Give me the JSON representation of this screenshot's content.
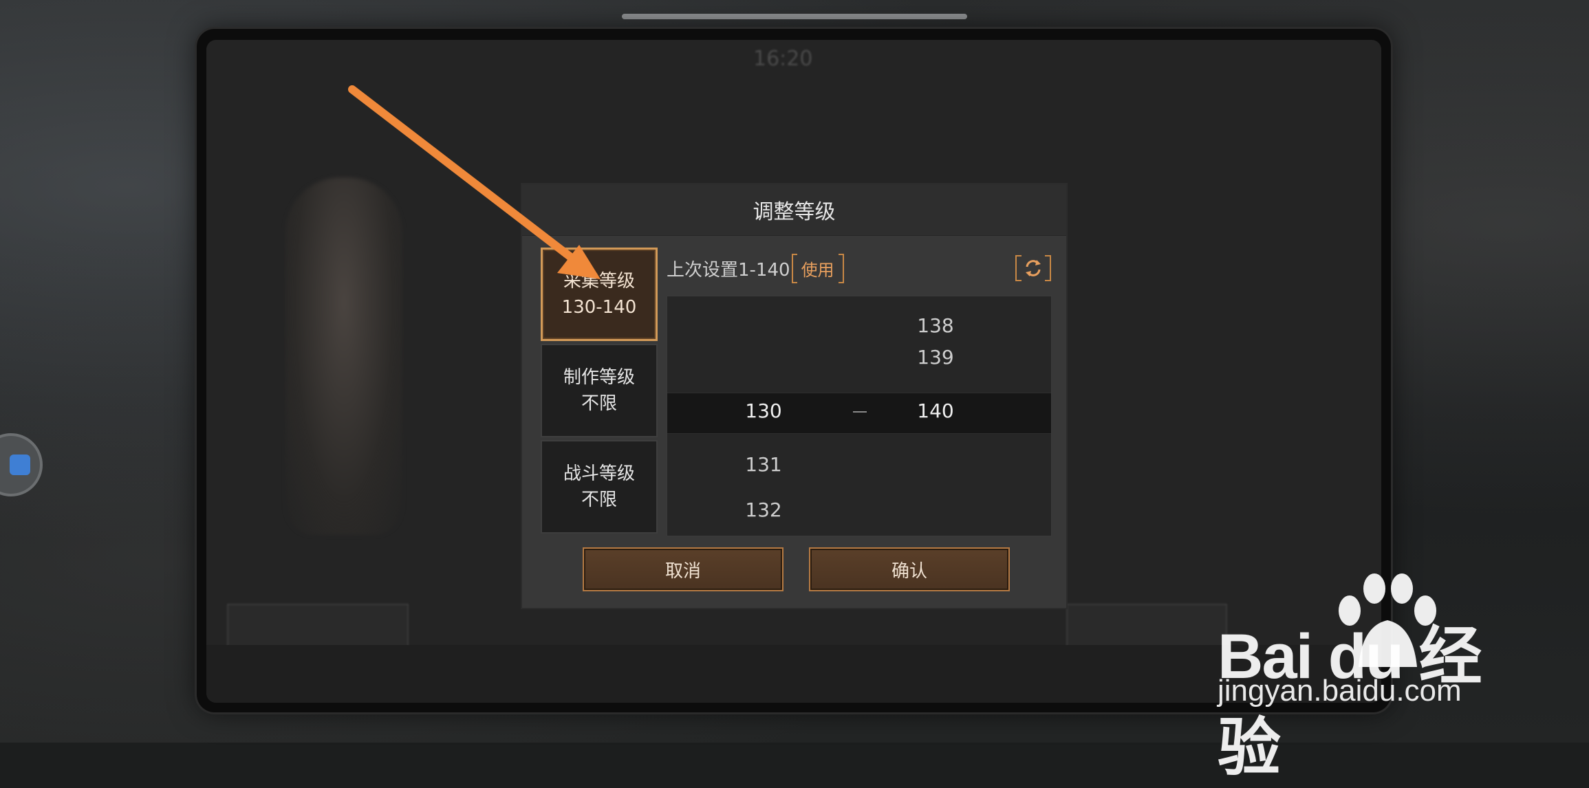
{
  "dialog": {
    "title": "调整等级",
    "tabs": [
      {
        "line1": "采集等级",
        "line2": "130-140",
        "active": true
      },
      {
        "line1": "制作等级",
        "line2": "不限",
        "active": false
      },
      {
        "line1": "战斗等级",
        "line2": "不限",
        "active": false
      }
    ],
    "last_setting_label": "上次设置1-140",
    "use_label": "使用",
    "refresh_icon": "refresh-icon",
    "picker": {
      "left_column": [
        {
          "value": "130",
          "selected": true
        },
        {
          "value": "131",
          "selected": false
        },
        {
          "value": "132",
          "selected": false
        }
      ],
      "right_column": [
        {
          "value": "138",
          "selected": false
        },
        {
          "value": "139",
          "selected": false
        },
        {
          "value": "140",
          "selected": true
        }
      ],
      "separator": "—"
    },
    "cancel_label": "取消",
    "confirm_label": "确认"
  },
  "background": {
    "clock": "16:20"
  },
  "watermark": {
    "brand": "Bai du 经验",
    "url": "jingyan.baidu.com"
  },
  "colors": {
    "accent": "#d39a58",
    "arrow": "#f0893a",
    "dialog_bg": "#383838",
    "button_bg": "#4f3725"
  }
}
